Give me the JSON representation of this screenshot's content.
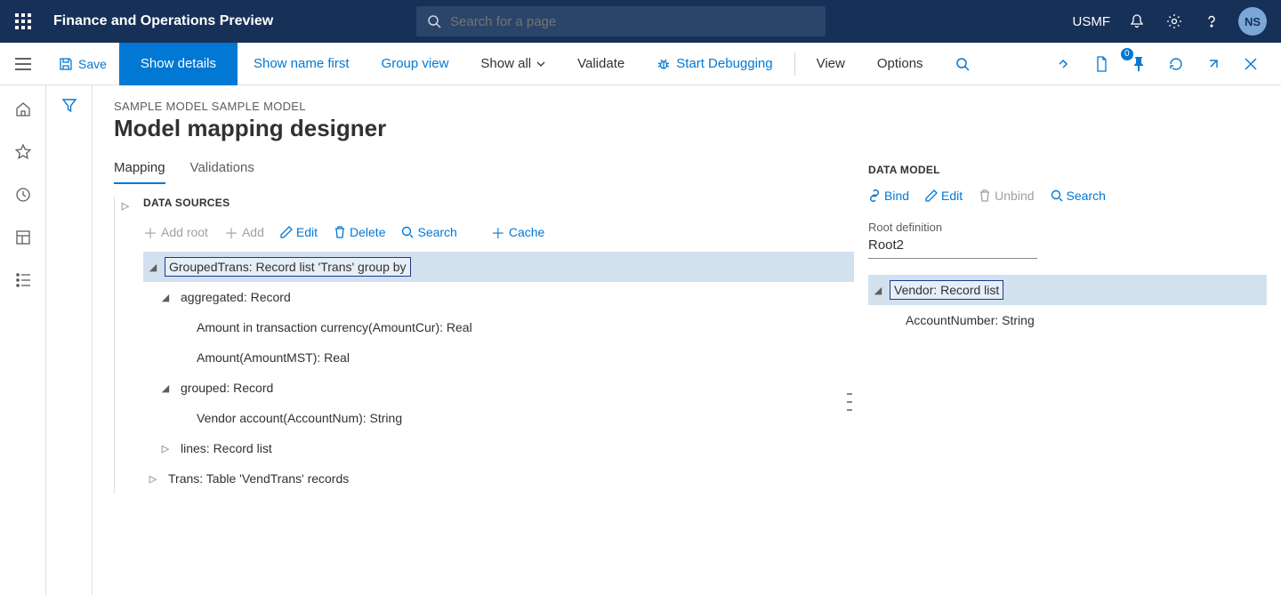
{
  "topbar": {
    "title": "Finance and Operations Preview",
    "searchPlaceholder": "Search for a page",
    "company": "USMF",
    "avatar": "NS"
  },
  "actionbar": {
    "save": "Save",
    "showDetails": "Show details",
    "showNameFirst": "Show name first",
    "groupView": "Group view",
    "showAll": "Show all",
    "validate": "Validate",
    "startDebugging": "Start Debugging",
    "view": "View",
    "options": "Options",
    "badge": "0"
  },
  "page": {
    "breadcrumb": "SAMPLE MODEL SAMPLE MODEL",
    "title": "Model mapping designer",
    "tabs": {
      "mapping": "Mapping",
      "validations": "Validations"
    }
  },
  "ds": {
    "title": "DATA SOURCES",
    "addRoot": "Add root",
    "add": "Add",
    "edit": "Edit",
    "delete": "Delete",
    "search": "Search",
    "cache": "Cache",
    "tree": {
      "n1": "GroupedTrans: Record list 'Trans' group by",
      "n2": "aggregated: Record",
      "n3": "Amount in transaction currency(AmountCur): Real",
      "n4": "Amount(AmountMST): Real",
      "n5": "grouped: Record",
      "n6": "Vendor account(AccountNum): String",
      "n7": "lines: Record list",
      "n8": "Trans: Table 'VendTrans' records"
    }
  },
  "dm": {
    "title": "DATA MODEL",
    "bind": "Bind",
    "edit": "Edit",
    "unbind": "Unbind",
    "search": "Search",
    "rootLabel": "Root definition",
    "rootVal": "Root2",
    "tree": {
      "n1": "Vendor: Record list",
      "n2": "AccountNumber: String"
    }
  }
}
